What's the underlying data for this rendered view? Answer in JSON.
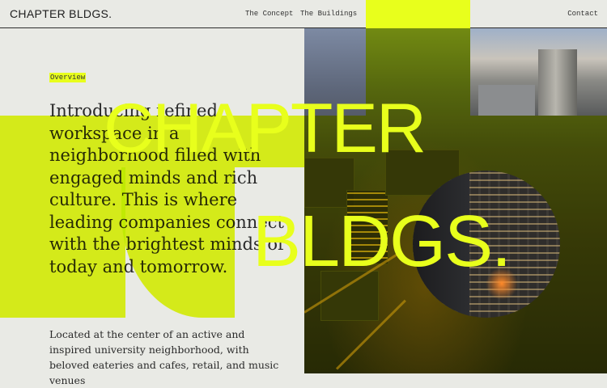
{
  "header": {
    "logo": "CHAPTER BLDGS.",
    "nav": [
      "The Concept",
      "The Buildings"
    ],
    "contact": "Contact"
  },
  "main": {
    "tag": "Overview",
    "intro": "Introducing refined workspace in a neighborhood filled with engaged minds and rich culture. This is where leading companies connect with the brightest minds of today and tomorrow.",
    "sub": "Located at the center of an active and inspired university neighborhood, with beloved eateries and cafes, retail, and music venues"
  },
  "hero": {
    "line1": "CHAPTER",
    "line2": "BLDGS."
  },
  "colors": {
    "accent": "#e8ff1c",
    "background": "#e9eae5",
    "text": "#2a2a2a"
  }
}
